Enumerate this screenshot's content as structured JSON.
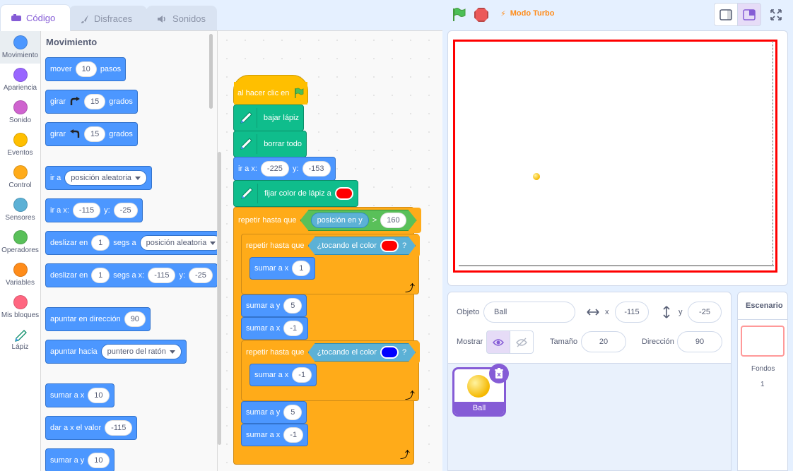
{
  "tabs": {
    "code": "Código",
    "costumes": "Disfraces",
    "sounds": "Sonidos"
  },
  "categories": [
    {
      "label": "Movimiento",
      "color": "#4c97ff"
    },
    {
      "label": "Apariencia",
      "color": "#9966ff"
    },
    {
      "label": "Sonido",
      "color": "#cf63cf"
    },
    {
      "label": "Eventos",
      "color": "#ffbf00"
    },
    {
      "label": "Control",
      "color": "#ffab19"
    },
    {
      "label": "Sensores",
      "color": "#5cb1d6"
    },
    {
      "label": "Operadores",
      "color": "#59c059"
    },
    {
      "label": "Variables",
      "color": "#ff8c1a"
    },
    {
      "label": "Mis bloques",
      "color": "#ff6680"
    },
    {
      "label": "Lápiz",
      "icon": "pen-icon"
    }
  ],
  "palette": {
    "title": "Movimiento",
    "move": {
      "a": "mover",
      "v": "10",
      "b": "pasos"
    },
    "turn_right": {
      "a": "girar",
      "v": "15",
      "b": "grados"
    },
    "turn_left": {
      "a": "girar",
      "v": "15",
      "b": "grados"
    },
    "goto": {
      "a": "ir a",
      "dd": "posición aleatoria"
    },
    "goto_xy": {
      "a": "ir a x:",
      "x": "-115",
      "b": "y:",
      "y": "-25"
    },
    "glide": {
      "a": "deslizar en",
      "v": "1",
      "b": "segs a",
      "dd": "posición aleatoria"
    },
    "glide_xy": {
      "a": "deslizar en",
      "v": "1",
      "b": "segs a x:",
      "x": "-115",
      "c": "y:",
      "y": "-25"
    },
    "point_dir": {
      "a": "apuntar en dirección",
      "v": "90"
    },
    "point_towards": {
      "a": "apuntar hacia",
      "dd": "puntero del ratón"
    },
    "change_x": {
      "a": "sumar a x",
      "v": "10"
    },
    "set_x": {
      "a": "dar a x el valor",
      "v": "-115"
    },
    "change_y": {
      "a": "sumar a y",
      "v": "10"
    }
  },
  "script": {
    "hat": "al hacer clic en",
    "pen_down": "bajar lápiz",
    "erase_all": "borrar todo",
    "goto": {
      "a": "ir a x:",
      "x": "-225",
      "b": "y:",
      "y": "-153"
    },
    "set_pen_color": "fijar color de lápiz a",
    "outer_until": {
      "a": "repetir hasta que",
      "reporter": "posición en y",
      "op": ">",
      "value": "160"
    },
    "inner_until_1": {
      "a": "repetir hasta que",
      "sense": "¿tocando el color",
      "q": "?"
    },
    "change_x_1": {
      "a": "sumar a x",
      "v": "1"
    },
    "change_y_1": {
      "a": "sumar a y",
      "v": "5"
    },
    "change_x_2": {
      "a": "sumar a x",
      "v": "-1"
    },
    "inner_until_2": {
      "a": "repetir hasta que",
      "sense": "¿tocando el color",
      "q": "?"
    },
    "change_x_3": {
      "a": "sumar a x",
      "v": "-1"
    },
    "change_y_2": {
      "a": "sumar a y",
      "v": "5"
    },
    "change_x_4": {
      "a": "sumar a x",
      "v": "-1"
    }
  },
  "colors": {
    "pen": "#ff0000",
    "touch1": "#ff0000",
    "touch2": "#0000ff"
  },
  "controls": {
    "turbo": "Modo Turbo"
  },
  "sprite_info": {
    "object_label": "Objeto",
    "object_name": "Ball",
    "x_label": "x",
    "x_value": "-115",
    "y_label": "y",
    "y_value": "-25",
    "show_label": "Mostrar",
    "size_label": "Tamaño",
    "size_value": "20",
    "direction_label": "Dirección",
    "direction_value": "90"
  },
  "sprites": [
    {
      "name": "Ball"
    }
  ],
  "backdrop": {
    "title": "Escenario",
    "label": "Fondos",
    "count": "1"
  }
}
